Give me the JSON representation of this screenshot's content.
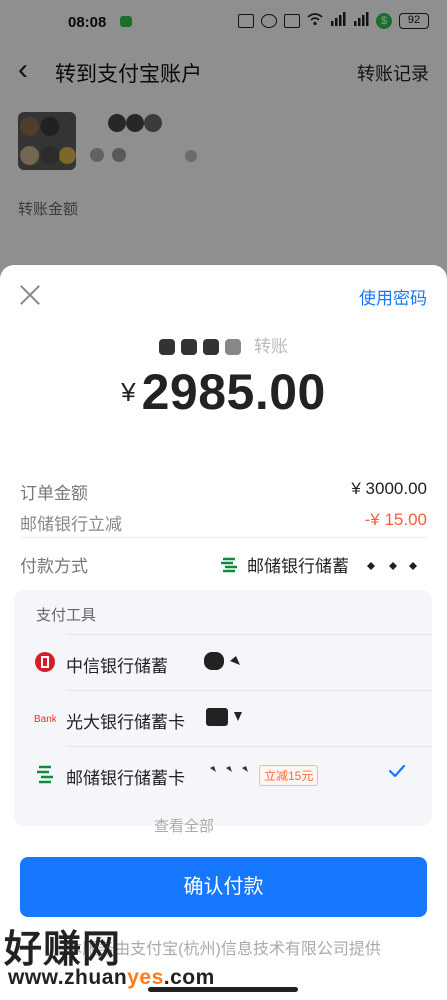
{
  "status_bar": {
    "time": "08:08",
    "battery": "92"
  },
  "header": {
    "title": "转到支付宝账户",
    "record_link": "转账记录"
  },
  "background": {
    "amount_label": "转账金额"
  },
  "sheet": {
    "use_password": "使用密码",
    "payee_suffix": "转账",
    "currency": "¥",
    "amount": "2985.00",
    "order_label": "订单金额",
    "order_value": "¥ 3000.00",
    "discount_label": "邮储银行立减",
    "discount_value": "-¥ 15.00",
    "method_label": "付款方式",
    "method_value": "邮储银行储蓄",
    "tools_title": "支付工具",
    "tools": [
      {
        "name": "中信银行储蓄",
        "icon": "citic-bank-icon"
      },
      {
        "name": "光大银行储蓄卡",
        "icon": "ceb-bank-icon"
      },
      {
        "name": "邮储银行储蓄卡",
        "icon": "psbc-bank-icon",
        "tag": "立减15元",
        "selected": true
      }
    ],
    "tools_more": "查看全部",
    "confirm": "确认付款",
    "provider": "本服务由支付宝(杭州)信息技术有限公司提供"
  },
  "watermark": {
    "text": "好赚网",
    "url_prefix": "www.zhuan",
    "url_highlight": "yes",
    "url_suffix": ".com"
  },
  "colors": {
    "accent": "#1677ff",
    "discount": "#ff5a3c",
    "psbc_green": "#0f8c3a"
  }
}
